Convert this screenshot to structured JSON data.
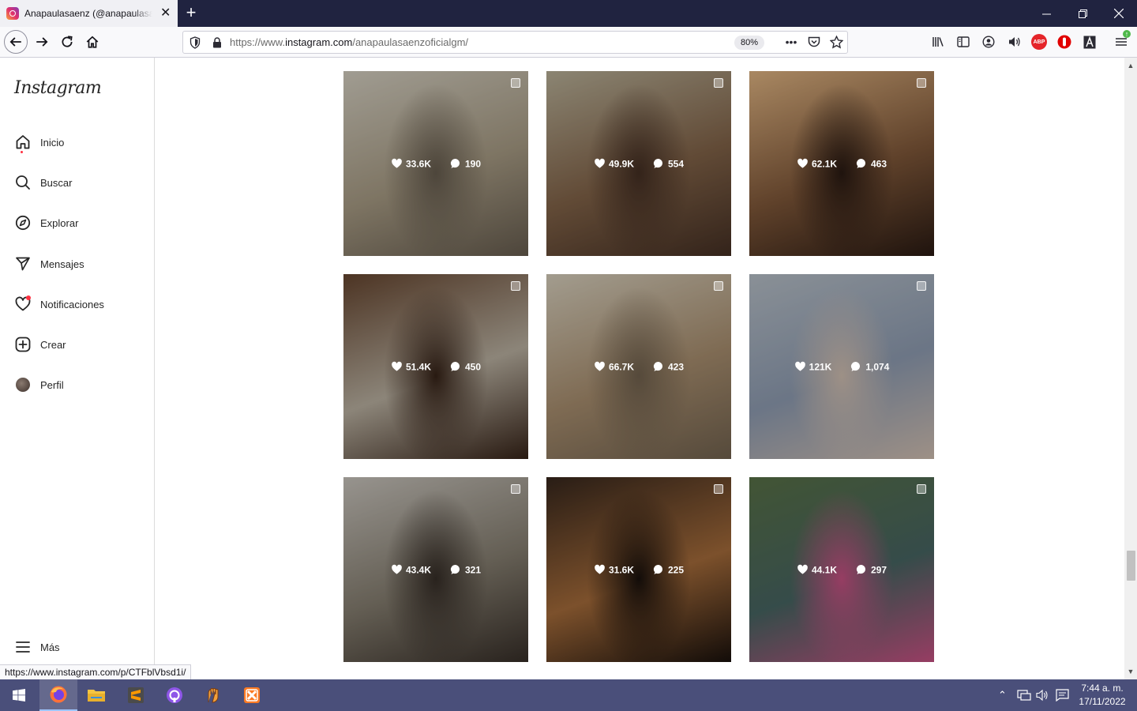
{
  "browser": {
    "tab_title": "Anapaulasaenz (@anapaulasaenzoficialgm)",
    "url_prefix": "https://www.",
    "url_host": "instagram.com",
    "url_path": "/anapaulasaenzoficialgm/",
    "zoom": "80%",
    "status_url": "https://www.instagram.com/p/CTFblVbsd1i/"
  },
  "sidebar": {
    "logo": "Instagram",
    "items": [
      {
        "label": "Inicio",
        "icon": "home-icon"
      },
      {
        "label": "Buscar",
        "icon": "search-icon"
      },
      {
        "label": "Explorar",
        "icon": "compass-icon"
      },
      {
        "label": "Mensajes",
        "icon": "send-icon"
      },
      {
        "label": "Notificaciones",
        "icon": "heart-icon"
      },
      {
        "label": "Crear",
        "icon": "plus-square-icon"
      },
      {
        "label": "Perfil",
        "icon": "avatar"
      }
    ],
    "more": "Más"
  },
  "posts": [
    {
      "likes": "33.6K",
      "comments": "190",
      "colors": [
        "#e6e0d1",
        "#b5a88f",
        "#6f6455"
      ]
    },
    {
      "likes": "49.9K",
      "comments": "554",
      "colors": [
        "#c8bfa5",
        "#8c6b4e",
        "#4a3326"
      ]
    },
    {
      "likes": "62.1K",
      "comments": "463",
      "colors": [
        "#f2c38d",
        "#8a5f3e",
        "#2d1c14"
      ]
    },
    {
      "likes": "51.4K",
      "comments": "450",
      "colors": [
        "#6e4b33",
        "#c9bfae",
        "#3a2519"
      ]
    },
    {
      "likes": "66.7K",
      "comments": "423",
      "colors": [
        "#e9e0cc",
        "#b69a78",
        "#7b6a55"
      ]
    },
    {
      "likes": "121K",
      "comments": "1,074",
      "colors": [
        "#c6cfd8",
        "#9aa9c0",
        "#e2cfc1"
      ]
    },
    {
      "likes": "43.4K",
      "comments": "321",
      "colors": [
        "#d9d4cc",
        "#8f8778",
        "#3b322b"
      ]
    },
    {
      "likes": "31.6K",
      "comments": "225",
      "colors": [
        "#3b2a1f",
        "#b2743f",
        "#1b120d"
      ]
    },
    {
      "likes": "44.1K",
      "comments": "297",
      "colors": [
        "#5f7a4c",
        "#4d6d6a",
        "#d8588e"
      ]
    }
  ],
  "taskbar": {
    "time": "7:44 a. m.",
    "date": "17/11/2022"
  },
  "theme": {
    "titlebar": "#202340",
    "taskbar": "#4a4f7a",
    "notification_dot": "#ff3040"
  }
}
